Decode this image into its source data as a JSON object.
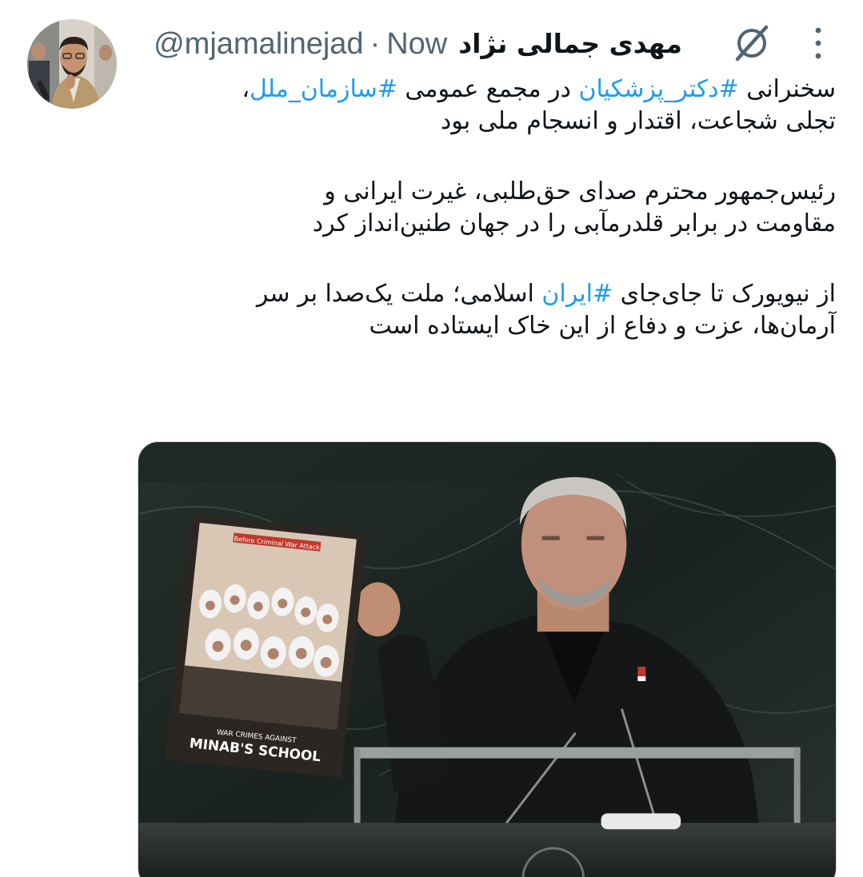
{
  "tweet": {
    "author": {
      "display_name": "مهدی جمالی نژاد",
      "handle": "@mjamalinejad",
      "separator": "·",
      "time": "Now"
    },
    "icons": {
      "grok": "grok-icon",
      "more": "more-vertical-icon"
    },
    "body": {
      "p1": {
        "l1_a": "سخنرانی ",
        "l1_tag1": "#دکتر_پزشکیان",
        "l1_b": " در مجمع عمومی ",
        "l1_tag2": "#سازمان_ملل",
        "l1_c": "،",
        "l2": "تجلی شجاعت، اقتدار و انسجام ملی بود"
      },
      "p2": {
        "l1": "رئیس‌جمهور محترم صدای حق‌طلبی، غیرت ایرانی و",
        "l2": "مقاومت در برابر قلدرمآبی را در جهان طنین‌انداز کرد"
      },
      "p3": {
        "l1_a": "از نیویورک تا جای‌جای ",
        "l1_tag": "#ایران",
        "l1_b": " اسلامی؛ ملت یک‌صدا بر سر",
        "l2": "آرمان‌ها، عزت و دفاع از این خاک ایستاده است"
      }
    },
    "media": {
      "poster_banner": "Before Criminal War Attack",
      "poster_subtitle": "WAR CRIMES AGAINST",
      "poster_title": "MINAB'S SCHOOL"
    }
  },
  "colors": {
    "text": "#0f1419",
    "secondary": "#536471",
    "hashtag": "#1d9bf0",
    "background": "#ffffff"
  }
}
